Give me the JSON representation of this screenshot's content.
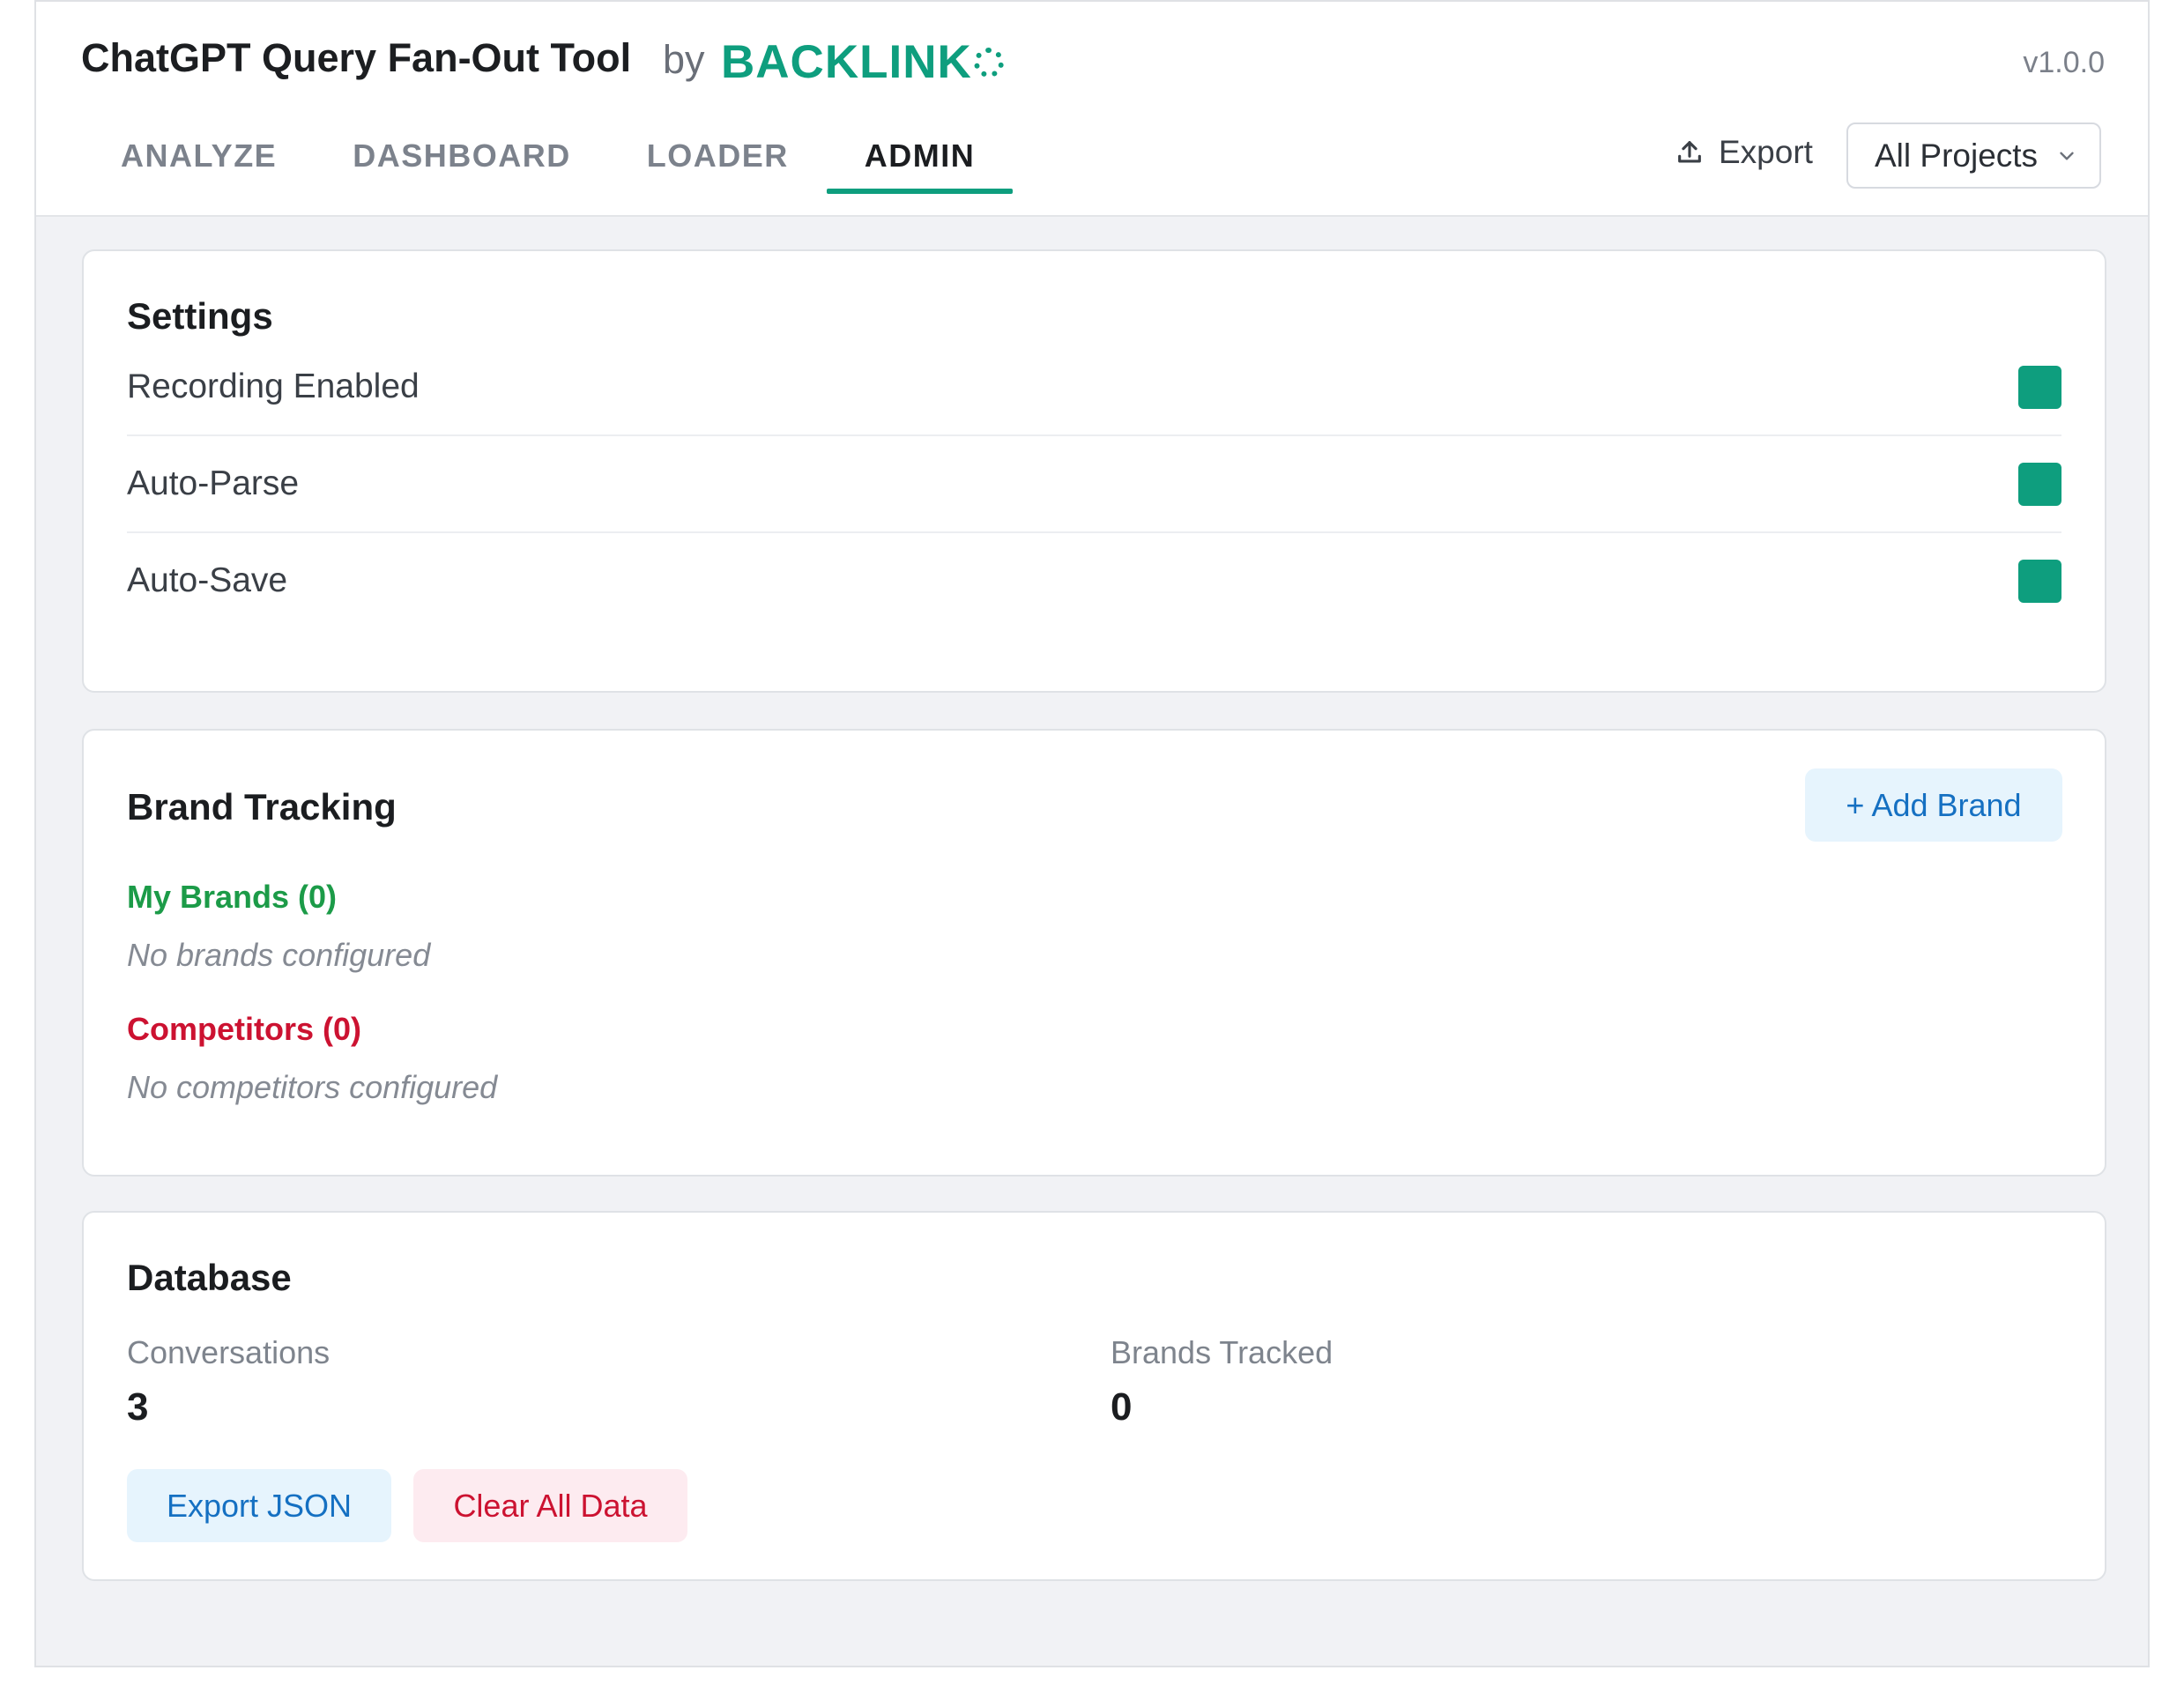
{
  "header": {
    "title": "ChatGPT Query Fan-Out Tool",
    "by": "by",
    "logo_text": "BACKLINK",
    "logo_ring_icon": "ring-o-icon",
    "version": "v1.0.0",
    "brand_color": "#0e9e7e"
  },
  "tabs": [
    {
      "label": "ANALYZE",
      "active": false
    },
    {
      "label": "DASHBOARD",
      "active": false
    },
    {
      "label": "LOADER",
      "active": false
    },
    {
      "label": "ADMIN",
      "active": true
    }
  ],
  "toolbar": {
    "export_label": "Export",
    "export_icon": "upload-icon",
    "project_select": {
      "value": "All Projects",
      "icon": "chevron-down-icon"
    }
  },
  "settings": {
    "title": "Settings",
    "items": [
      {
        "label": "Recording Enabled",
        "enabled": true
      },
      {
        "label": "Auto-Parse",
        "enabled": true
      },
      {
        "label": "Auto-Save",
        "enabled": true
      }
    ]
  },
  "brand_tracking": {
    "title": "Brand Tracking",
    "add_button": "+ Add Brand",
    "my_brands": {
      "title": "My Brands (0)",
      "empty": "No brands configured",
      "color": "#1c9b48"
    },
    "competitors": {
      "title": "Competitors (0)",
      "empty": "No competitors configured",
      "color": "#cc1231"
    }
  },
  "database": {
    "title": "Database",
    "stats": [
      {
        "label": "Conversations",
        "value": "3"
      },
      {
        "label": "Brands Tracked",
        "value": "0"
      }
    ],
    "export_button": "Export JSON",
    "clear_button": "Clear All Data"
  }
}
